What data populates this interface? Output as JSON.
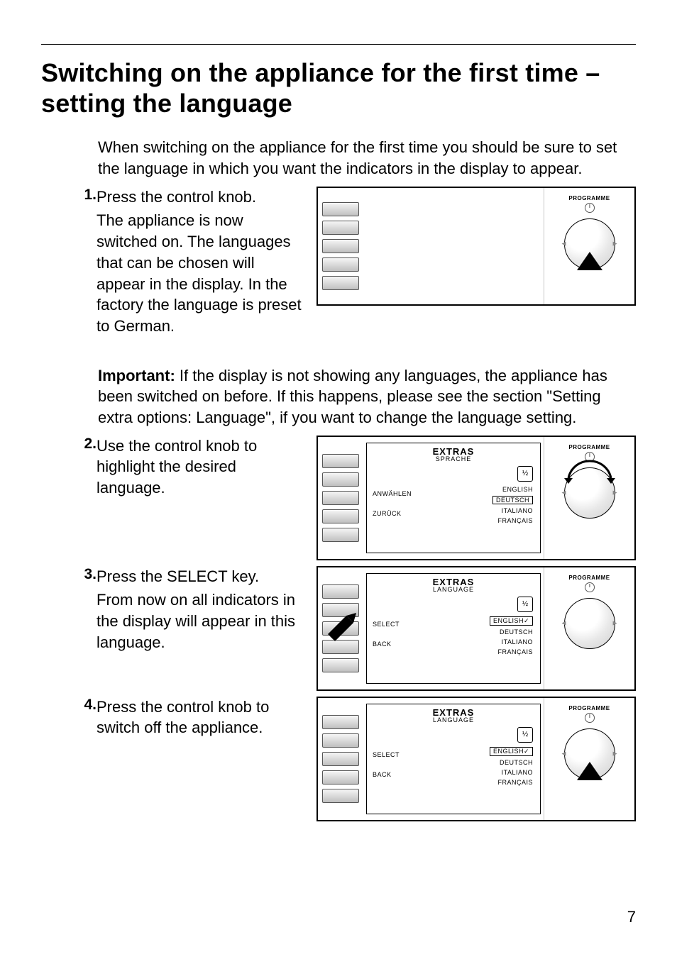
{
  "title": "Switching on the appliance for the first time – setting the language",
  "intro": "When switching on the appliance for the first time you should be sure to set the language in which you want the indicators in the display to appear.",
  "steps": {
    "s1": {
      "num": "1.",
      "line1": "Press the control knob.",
      "line2": "The appliance is now switched on. The languages that can be chosen will appear in the display. In the factory the language is preset to German."
    },
    "s2": {
      "num": "2.",
      "text": "Use the control knob to highlight the desired language."
    },
    "s3": {
      "num": "3.",
      "line1": "Press the SELECT key.",
      "line2": "From now on all indicators in the display will appear in this language."
    },
    "s4": {
      "num": "4.",
      "text": "Press the control knob to switch off the appliance."
    }
  },
  "important": {
    "label": "Important:",
    "text": " If the display is not showing any languages, the appliance has been switched on before. If this happens, please see the section \"Setting extra options: Language\", if you want to change the language setting."
  },
  "panel": {
    "programme": "PROGRAMME",
    "lcd": {
      "title": "EXTRAS",
      "sub_de": "SPRACHE",
      "sub_en": "LANGUAGE",
      "left_de_sel": "ANWÄHLEN",
      "left_de_back": "ZURÜCK",
      "left_en_sel": "SELECT",
      "left_en_back": "BACK",
      "langs": {
        "en": "ENGLISH",
        "en_chk": "ENGLISH✓",
        "de": "DEUTSCH",
        "it": "ITALIANO",
        "fr": "FRANÇAIS"
      },
      "icon": "½"
    }
  },
  "page_number": "7"
}
